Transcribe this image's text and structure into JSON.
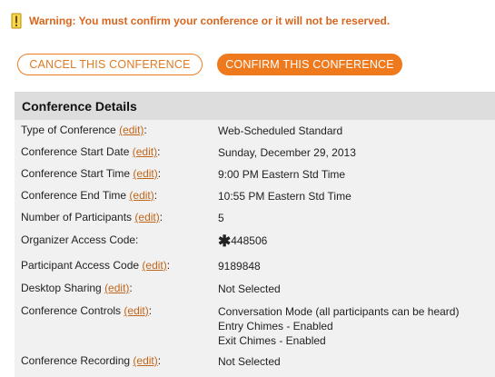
{
  "warning": {
    "text": "Warning:  You must confirm your conference or it will not be reserved."
  },
  "buttons": {
    "cancel": "CANCEL THIS CONFERENCE",
    "confirm": "CONFIRM THIS CONFERENCE"
  },
  "details": {
    "title": "Conference Details",
    "edit_label": "(edit)",
    "rows": [
      {
        "label": "Type of Conference",
        "value_lines": [
          "Web-Scheduled Standard"
        ]
      },
      {
        "label": "Conference Start Date",
        "value_lines": [
          "Sunday, December 29, 2013"
        ]
      },
      {
        "label": "Conference Start Time",
        "value_lines": [
          "9:00 PM Eastern Std Time"
        ]
      },
      {
        "label": "Conference End Time",
        "value_lines": [
          "10:55 PM Eastern Std Time"
        ]
      },
      {
        "label": "Number of Participants",
        "value_lines": [
          "5"
        ]
      },
      {
        "label": "Organizer Access Code:",
        "value_lines": [
          "448506"
        ],
        "no_edit": true,
        "masked": true
      },
      {
        "label": "Participant Access Code",
        "value_lines": [
          "9189848"
        ]
      },
      {
        "label": "Desktop Sharing",
        "value_lines": [
          "Not Selected"
        ]
      },
      {
        "label": "Conference Controls",
        "value_lines": [
          "Conversation Mode (all participants can be heard)",
          "Entry Chimes - Enabled",
          "Exit Chimes - Enabled"
        ]
      },
      {
        "label": "Conference Recording",
        "value_lines": [
          "Not Selected"
        ]
      }
    ]
  },
  "colors": {
    "accent": "#ef7a1d",
    "warning_text": "#d9661f",
    "link": "#c0661a",
    "panel_bg": "#f1f1f1",
    "header_bg": "#dddddd"
  }
}
